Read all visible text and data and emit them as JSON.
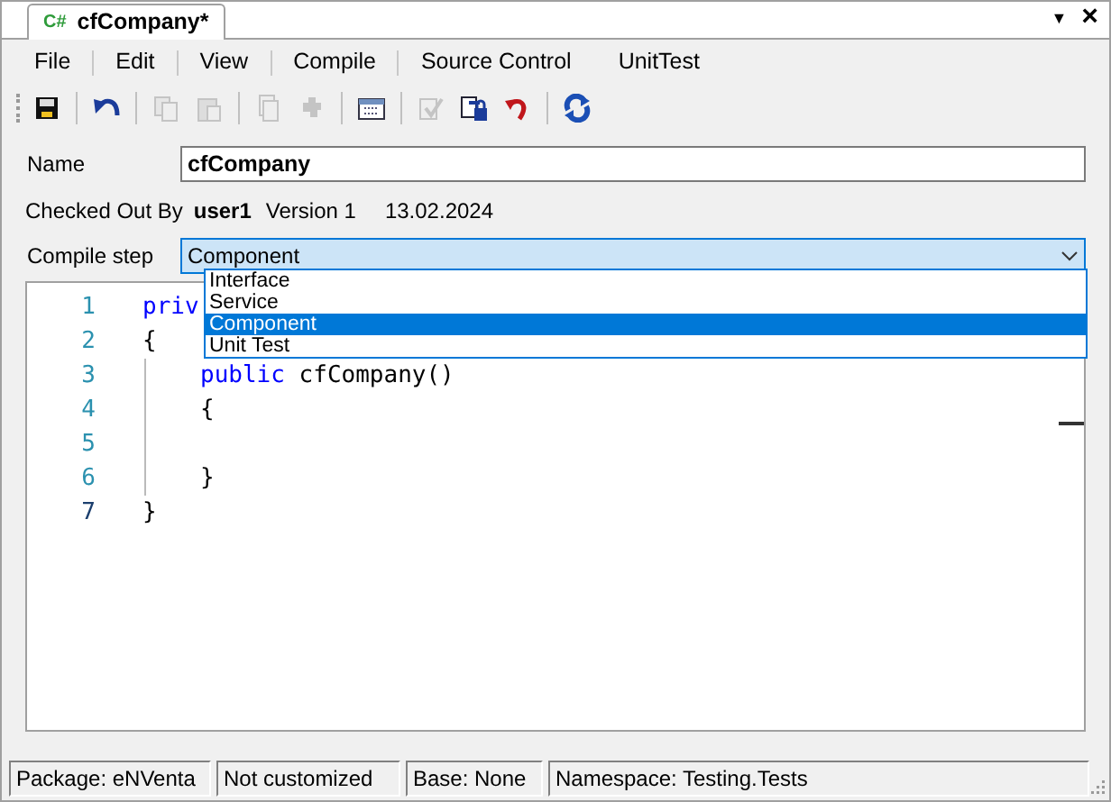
{
  "document_tab": {
    "badge": "C#",
    "title": "cfCompany*",
    "selected": true
  },
  "tab_controls": [
    "▼",
    "×"
  ],
  "menu": [
    "File",
    "Edit",
    "View",
    "Compile",
    "Source Control",
    "UnitTest"
  ],
  "toolbar": [
    {
      "kind": "save",
      "disabled": false
    },
    {
      "kind": "separator"
    },
    {
      "kind": "undo",
      "disabled": false
    },
    {
      "kind": "separator"
    },
    {
      "kind": "copy",
      "disabled": true
    },
    {
      "kind": "paste",
      "disabled": true
    },
    {
      "kind": "separator"
    },
    {
      "kind": "duplicate",
      "disabled": true
    },
    {
      "kind": "plugin",
      "disabled": true
    },
    {
      "kind": "separator"
    },
    {
      "kind": "calendar",
      "disabled": false
    },
    {
      "kind": "separator"
    },
    {
      "kind": "checkin",
      "disabled": true
    },
    {
      "kind": "checkout",
      "disabled": false
    },
    {
      "kind": "revert",
      "disabled": false
    },
    {
      "kind": "separator"
    },
    {
      "kind": "refresh",
      "disabled": false
    }
  ],
  "name_field": {
    "label": "Name",
    "value": "cfCompany"
  },
  "checkout_info": {
    "label": "Checked Out By",
    "user": "user1",
    "version": "Version 1",
    "date": "13.02.2024"
  },
  "compile_step": {
    "label": "Compile step",
    "value": "Component",
    "expanded": true,
    "options": [
      {
        "label": "Interface",
        "selected": false
      },
      {
        "label": "Service",
        "selected": false
      },
      {
        "label": "Component",
        "selected": true
      },
      {
        "label": "Unit Test",
        "selected": false
      }
    ]
  },
  "editor": {
    "lines": [
      {
        "number": "1",
        "current": false,
        "tokens": [
          {
            "kind": "keyword",
            "text": "priv"
          }
        ]
      },
      {
        "number": "2",
        "current": false,
        "tokens": [
          {
            "kind": "plain",
            "text": "{"
          }
        ]
      },
      {
        "number": "3",
        "current": false,
        "tokens": [
          {
            "kind": "keyword",
            "text": "public"
          },
          {
            "kind": "plain",
            "text": " cfCompany()"
          }
        ]
      },
      {
        "number": "4",
        "current": false,
        "tokens": [
          {
            "kind": "plain",
            "text": "{"
          }
        ]
      },
      {
        "number": "5",
        "current": false
      },
      {
        "number": "6",
        "current": false,
        "tokens": [
          {
            "kind": "plain",
            "text": "}"
          }
        ]
      },
      {
        "number": "7",
        "current": true,
        "tokens": [
          {
            "kind": "plain",
            "text": "}"
          }
        ]
      }
    ]
  },
  "status_bar": [
    "Package: eNVenta",
    "Not customized",
    "Base: None",
    "Namespace: Testing.Tests"
  ]
}
